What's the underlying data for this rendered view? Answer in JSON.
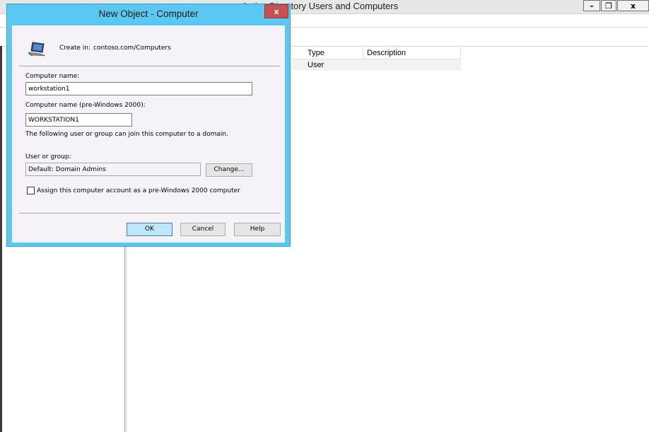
{
  "main_window": {
    "title": "Active Directory Users and Computers",
    "minimize_glyph": "–",
    "restore_glyph": "❐",
    "close_glyph": "x"
  },
  "list": {
    "columns": [
      "Type",
      "Description"
    ],
    "rows": [
      {
        "type": "User",
        "description": ""
      }
    ]
  },
  "dialog": {
    "title": "New Object - Computer",
    "close_glyph": "x",
    "create_in_label": "Create in:",
    "create_in_value": "contoso.com/Computers",
    "icon": "computer-icon",
    "computer_name_label": "Computer name:",
    "computer_name_value": "workstation1",
    "pre2000_label": "Computer name (pre-Windows 2000):",
    "pre2000_value": "WORKSTATION1",
    "join_note": "The following user or group can join this computer to a domain.",
    "user_group_label": "User or group:",
    "user_group_value": "Default: Domain Admins",
    "change_button": "Change...",
    "checkbox_label": "Assign this computer account as a pre-Windows 2000 computer",
    "checkbox_checked": false,
    "ok_button": "OK",
    "cancel_button": "Cancel",
    "help_button": "Help"
  },
  "colors": {
    "dialog_frame": "#5ac8f0",
    "close_button": "#c75050",
    "default_button": "#bee6fd"
  }
}
